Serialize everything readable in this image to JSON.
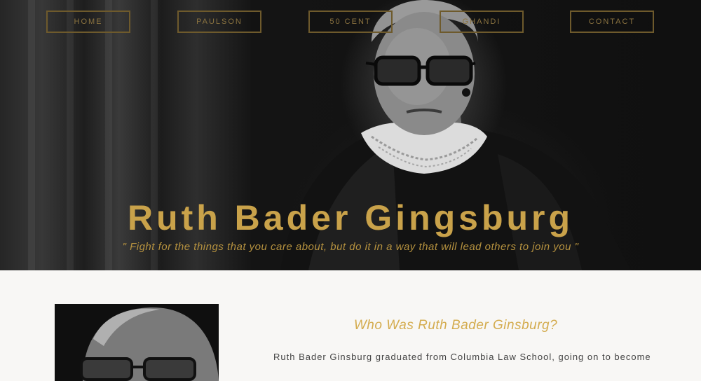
{
  "nav": {
    "items": [
      {
        "label": "HOME"
      },
      {
        "label": "PAULSON"
      },
      {
        "label": "50 CENT"
      },
      {
        "label": "GHANDI"
      },
      {
        "label": "CONTACT"
      }
    ]
  },
  "hero": {
    "title": "Ruth Bader Gingsburg",
    "quote": "\" Fight for the things that you care about, but do it in a way that will lead others to join you \""
  },
  "about": {
    "title": "Who Was Ruth Bader Ginsburg?",
    "text": "Ruth Bader Ginsburg graduated from Columbia Law School, going on to become"
  },
  "colors": {
    "accent": "#c9a24a",
    "nav_border": "#6e5a2c",
    "hero_bg": "#161616",
    "page_bg": "#f8f7f5"
  },
  "icons": {
    "hero_image": "portrait-photo",
    "profile_image": "portrait-photo"
  }
}
